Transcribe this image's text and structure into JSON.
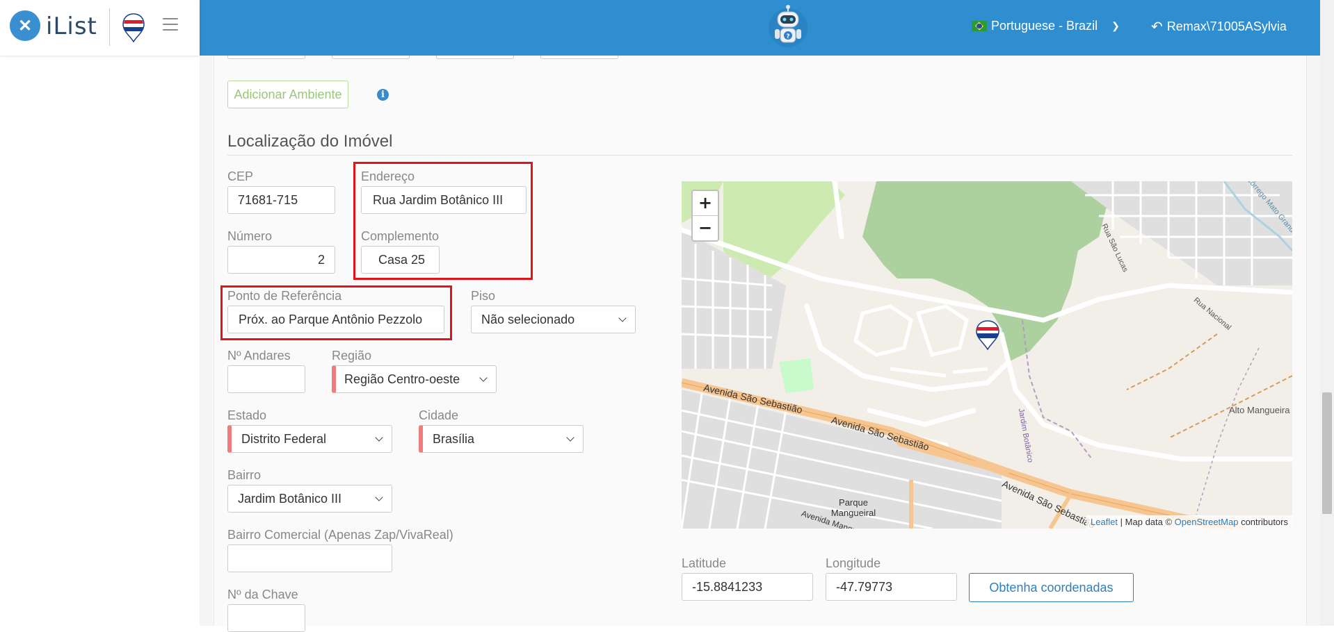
{
  "app": {
    "name": "iList"
  },
  "header": {
    "language": "Portuguese - Brazil",
    "user": "Remax\\71005ASylvia"
  },
  "form": {
    "add_room_label": "Adicionar Ambiente",
    "section_title": "Localização do Imóvel",
    "cep": {
      "label": "CEP",
      "value": "71681-715"
    },
    "endereco": {
      "label": "Endereço",
      "value": "Rua Jardim Botânico III"
    },
    "numero": {
      "label": "Número",
      "value": "2"
    },
    "complemento": {
      "label": "Complemento",
      "value": "Casa 25"
    },
    "ponto_referencia": {
      "label": "Ponto de Referência",
      "value": "Próx. ao Parque Antônio Pezzolo"
    },
    "piso": {
      "label": "Piso",
      "value": "Não selecionado"
    },
    "andares": {
      "label": "Nº Andares",
      "value": ""
    },
    "regiao": {
      "label": "Região",
      "value": "Região Centro-oeste"
    },
    "estado": {
      "label": "Estado",
      "value": "Distrito Federal"
    },
    "cidade": {
      "label": "Cidade",
      "value": "Brasília"
    },
    "bairro": {
      "label": "Bairro",
      "value": "Jardim Botânico III"
    },
    "bairro_comercial": {
      "label": "Bairro Comercial (Apenas Zap/VivaReal)",
      "value": ""
    },
    "chave": {
      "label": "Nº da Chave",
      "value": ""
    },
    "latitude": {
      "label": "Latitude",
      "value": "-15.8841233"
    },
    "longitude": {
      "label": "Longitude",
      "value": "-47.79773"
    },
    "get_coords_label": "Obtenha coordenadas"
  },
  "map": {
    "zoom_in": "+",
    "zoom_out": "−",
    "attribution": {
      "leaflet": "Leaflet",
      "data_prefix": " | Map data © ",
      "osm": "OpenStreetMap",
      "suffix": " contributors"
    },
    "labels": {
      "road1": "Avenida São Sebastião",
      "road2": "Avenida São Sebastião",
      "road3": "Avenida São Sebastião",
      "road4": "Avenida Mangueiral",
      "park": "Parque Mangueiral",
      "alto": "Alto Mangueira",
      "nacional": "Rua Nacional",
      "jardim": "Jardim Botânico",
      "sao_lucas": "Rua São Lucas",
      "corrego": "Córrego Mato Grande"
    }
  },
  "colors": {
    "topbar": "#2f8ecf",
    "highlight": "#e0141b",
    "required_marker": "#ef7d7d"
  }
}
